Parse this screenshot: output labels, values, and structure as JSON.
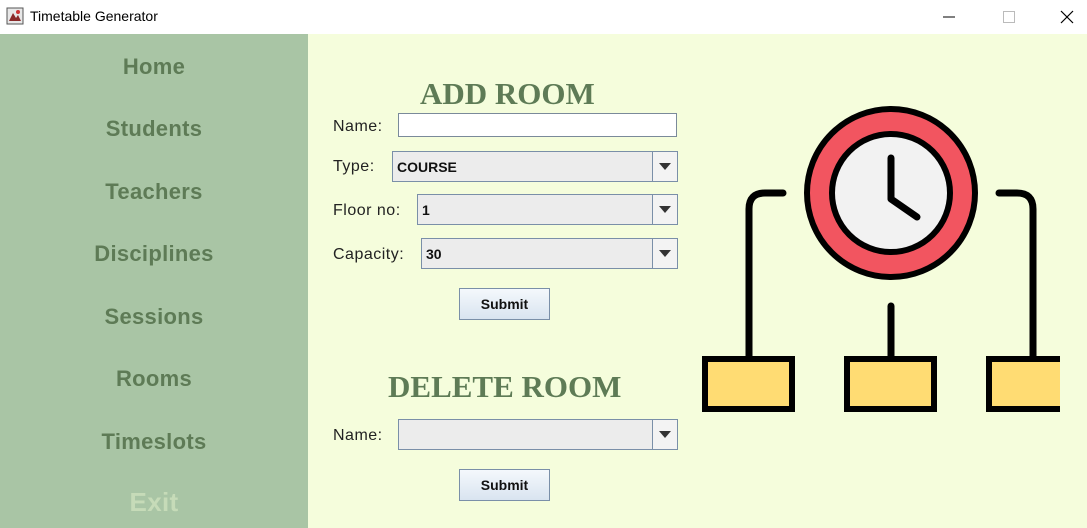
{
  "window": {
    "title": "Timetable Generator",
    "minimize": "—",
    "maximize": "☐",
    "close": "✕"
  },
  "sidebar": {
    "items": [
      {
        "label": "Home"
      },
      {
        "label": "Students"
      },
      {
        "label": "Teachers"
      },
      {
        "label": "Disciplines"
      },
      {
        "label": "Sessions"
      },
      {
        "label": "Rooms"
      },
      {
        "label": "Timeslots"
      },
      {
        "label": "Exit"
      }
    ]
  },
  "add_room": {
    "title": "ADD ROOM",
    "name_label": "Name:",
    "name_value": "",
    "type_label": "Type:",
    "type_value": "COURSE",
    "floor_label": "Floor no:",
    "floor_value": "1",
    "capacity_label": "Capacity:",
    "capacity_value": "30",
    "submit_label": "Submit"
  },
  "delete_room": {
    "title": "DELETE ROOM",
    "name_label": "Name:",
    "name_value": "",
    "submit_label": "Submit"
  },
  "colors": {
    "sidebar_bg": "#a9c5a5",
    "nav_text": "#5e7b56",
    "main_bg": "#f5fddc",
    "clock_ring": "#f25560",
    "box_fill": "#ffdc73"
  }
}
